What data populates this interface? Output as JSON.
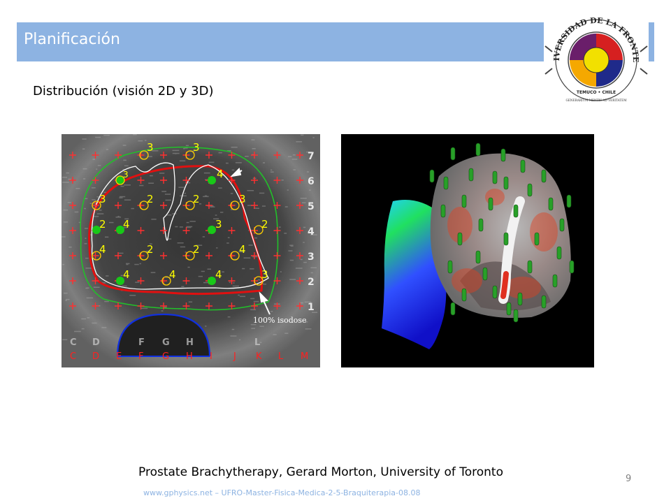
{
  "slide": {
    "title": "Planificación",
    "subtitle": "Distribución (visión 2D y 3D)",
    "caption": "Prostate Brachytherapy, Gerard Morton, University of Toronto",
    "page_number": "9",
    "footer": "www.gphysics.net – UFRO-Master-Fisica-Medica-2-5-Braquiterapia-08.08"
  },
  "logo": {
    "top_text": "UNIVERSIDAD DE LA FRONTERA",
    "city": "TEMUCO • CHILE",
    "motto": "GENERARIUM MENTIS AD VERITATEM"
  },
  "image_2d": {
    "isodose_label": "100% isodose",
    "row_labels": [
      "7",
      "6",
      "5",
      "4",
      "3",
      "2",
      "1"
    ],
    "col_labels": [
      "C",
      "D",
      "E",
      "F",
      "G",
      "H",
      "I",
      "J",
      "K",
      "L",
      "M"
    ],
    "seed_numbers": [
      "3",
      "3",
      "3",
      "4",
      "3",
      "2",
      "2",
      "3",
      "2",
      "4",
      "3",
      "2",
      "4",
      "2",
      "2",
      "4",
      "4",
      "4",
      "4",
      "3"
    ],
    "colors": {
      "grid_plus": "#ff3030",
      "isodose_100": "#e01010",
      "prostate_outline": "#ffffff",
      "outer_isodose": "#22c02a",
      "rectum": "#1030e0",
      "seed_number": "#ffff00",
      "needle_dot": "#18c818"
    }
  },
  "image_3d": {
    "colors": {
      "background": "#000000",
      "bladder_top": "#20d0ff",
      "bladder_bottom": "#1010ff",
      "seeds": "#28a028"
    }
  }
}
